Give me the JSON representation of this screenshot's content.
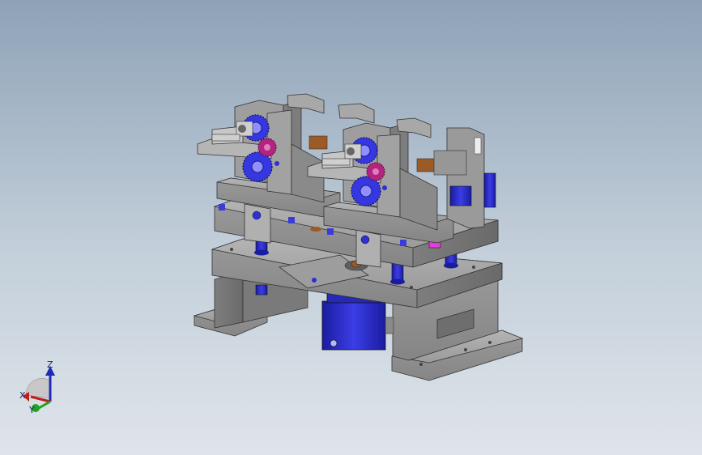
{
  "viewport": {
    "background_top": "#8ea2b7",
    "background_bottom": "#dfe4ea",
    "model": {
      "part_color": "#8a8a8a",
      "cylinder_color": "#2e2fd4",
      "gear_pink_color": "#b2247e",
      "bushing_color": "#9b5a26",
      "accent_magenta": "#e03fe0"
    }
  },
  "triad": {
    "z_label": "Z",
    "x_label": "X",
    "y_label": "Y",
    "z_color": "#1f2ab8",
    "x_color": "#c21c1c",
    "y_color": "#21a321"
  }
}
